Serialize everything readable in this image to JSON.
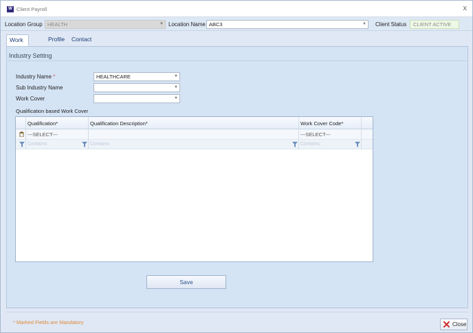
{
  "window": {
    "title": "Client Payroll",
    "app_icon": "W",
    "close_glyph": "x"
  },
  "topbar": {
    "location_group_label": "Location Group",
    "location_group_value": "HEALTH",
    "location_name_label": "Location Name",
    "location_name_value": "ABC3",
    "client_status_label": "Client Status",
    "client_status_value": "CLIENT ACTIVE"
  },
  "tabs": [
    {
      "label": "Work Cover",
      "active": true
    },
    {
      "label": "Profile",
      "active": false
    },
    {
      "label": "Contact Details",
      "active": false
    }
  ],
  "industry": {
    "group_title": "Industry Setting",
    "industry_name_label": "Industry Name",
    "required_mark": "*",
    "industry_name_value": "HEALTHCARE",
    "sub_industry_label": "Sub Industry Name",
    "sub_industry_value": "",
    "work_cover_label": "Work Cover",
    "work_cover_value": "",
    "grid_caption": "Qualification based Work Cover"
  },
  "grid": {
    "columns": [
      "Qualification*",
      "Qualification Description*",
      "Work Cover Code*"
    ],
    "new_row": {
      "qualification": "---SELECT---",
      "description": "",
      "work_cover_code": "---SELECT---"
    },
    "filter_placeholder": "Contains:"
  },
  "actions": {
    "save_label": "Save",
    "close_label": "Close"
  },
  "footer": {
    "mandatory_note": "* Marked Fields are Mandatory"
  },
  "colors": {
    "accent": "#1b3c78",
    "note": "#e08a3a",
    "close_x": "#d32f2f"
  },
  "icons": [
    "app-icon",
    "close-icon",
    "dropdown-arrow-icon",
    "trash-icon",
    "filter-icon",
    "close-x-icon"
  ]
}
